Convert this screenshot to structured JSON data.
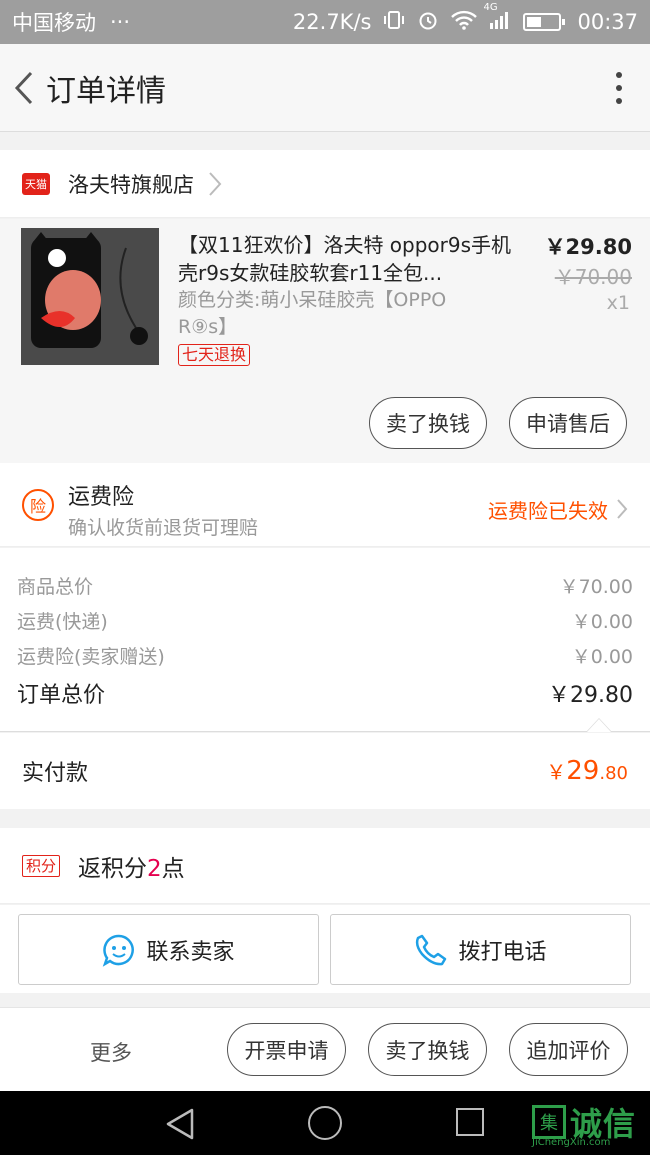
{
  "status_bar": {
    "carrier": "中国移动",
    "dots": "···",
    "speed": "22.7K/s",
    "network": "4G",
    "time": "00:37"
  },
  "header": {
    "title": "订单详情"
  },
  "store": {
    "badge": "天猫",
    "name": "洛夫特旗舰店"
  },
  "product": {
    "title": "【双11狂欢价】洛夫特 oppor9s手机壳r9s女款硅胶软套r11全包...",
    "variant": "颜色分类:萌小呆硅胶壳【OPPO R⑨s】",
    "badge": "七天退换",
    "price": "￥29.80",
    "original_price": "￥70.00",
    "quantity": "x1",
    "buttons": {
      "sell": "卖了换钱",
      "after_sale": "申请售后"
    }
  },
  "insurance": {
    "icon_label": "险",
    "title": "运费险",
    "subtitle": "确认收货前退货可理赔",
    "status": "运费险已失效"
  },
  "summary": {
    "rows": [
      {
        "label": "商品总价",
        "value": "￥70.00"
      },
      {
        "label": "运费(快递)",
        "value": "￥0.00"
      },
      {
        "label": "运费险(卖家赠送)",
        "value": "￥0.00"
      }
    ],
    "total_label": "订单总价",
    "total_value": "￥29.80"
  },
  "paid": {
    "label": "实付款",
    "currency": "￥",
    "integer": "29",
    "decimal": ".80"
  },
  "points": {
    "badge": "积分",
    "prefix": "返积分",
    "count": "2",
    "suffix": "点"
  },
  "contact": {
    "seller": "联系卖家",
    "phone": "拨打电话"
  },
  "actions": {
    "more": "更多",
    "invoice": "开票申请",
    "sell": "卖了换钱",
    "review": "追加评价"
  },
  "watermark": {
    "box": "集",
    "text": "诚信",
    "sub": "JiChengXin.com"
  },
  "colors": {
    "accent": "#ff5000",
    "tmall_red": "#e2231a",
    "points_pink": "#e5004f"
  }
}
